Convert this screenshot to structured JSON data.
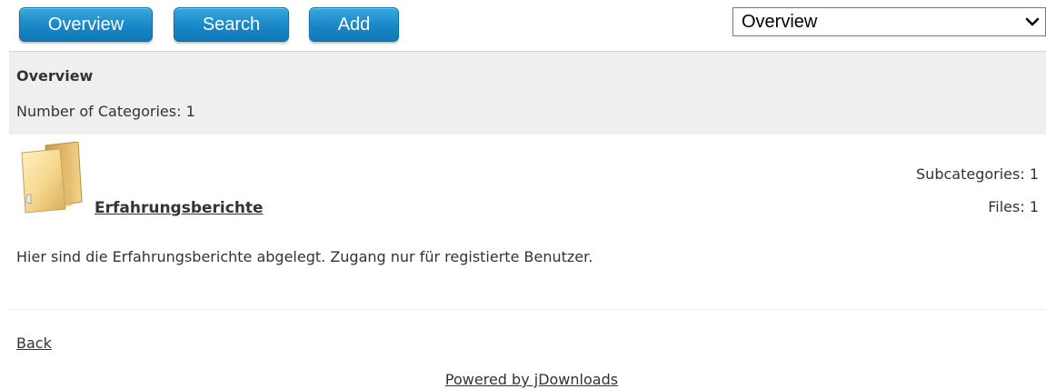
{
  "toolbar": {
    "overview_label": "Overview",
    "search_label": "Search",
    "add_label": "Add"
  },
  "jump_select": {
    "selected": "Overview"
  },
  "header": {
    "title": "Overview",
    "category_count": "Number of Categories: 1"
  },
  "category": {
    "icon": "folder-icon",
    "name": "Erfahrungsberichte",
    "subcategories": "Subcategories: 1",
    "files": "Files: 1",
    "description": "Hier sind die Erfahrungsberichte abgelegt. Zugang nur für registierte Benutzer."
  },
  "footer": {
    "back_label": "Back",
    "powered_by": "Powered by jDownloads"
  },
  "colors": {
    "button": "#1a87c6",
    "header_bg": "#efefef",
    "text": "#333333"
  }
}
